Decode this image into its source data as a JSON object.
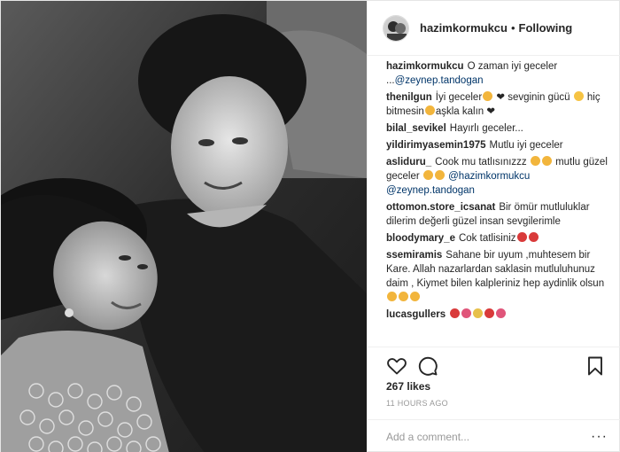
{
  "header": {
    "username": "hazimkormukcu",
    "separator": "•",
    "follow_status": "Following"
  },
  "comments": [
    {
      "user": "hazimkormukcu",
      "parts": [
        {
          "t": "text",
          "v": "O zaman iyi geceler ..."
        },
        {
          "t": "mention",
          "v": "@zeynep.tandogan"
        }
      ]
    },
    {
      "user": "thenilgun",
      "parts": [
        {
          "t": "text",
          "v": "İyi geceler"
        },
        {
          "t": "emoji",
          "c": "#f2b53c"
        },
        {
          "t": "text",
          "v": " ❤ sevginin gücü "
        },
        {
          "t": "emoji",
          "c": "#f6c343"
        },
        {
          "t": "text",
          "v": " hiç bitmesin"
        },
        {
          "t": "emoji",
          "c": "#f2b53c"
        },
        {
          "t": "text",
          "v": "aşkla kalın ❤"
        }
      ]
    },
    {
      "user": "bilal_sevikel",
      "parts": [
        {
          "t": "text",
          "v": "Hayırlı geceler..."
        }
      ]
    },
    {
      "user": "yildirimyasemin1975",
      "parts": [
        {
          "t": "text",
          "v": "Mutlu iyi geceler"
        }
      ]
    },
    {
      "user": "asliduru_",
      "parts": [
        {
          "t": "text",
          "v": "Cook mu tatlısınızzz "
        },
        {
          "t": "emoji",
          "c": "#f2b53c"
        },
        {
          "t": "emoji",
          "c": "#f2b53c"
        },
        {
          "t": "text",
          "v": " mutlu güzel geceler "
        },
        {
          "t": "emoji",
          "c": "#f2b53c"
        },
        {
          "t": "emoji",
          "c": "#f2b53c"
        },
        {
          "t": "text",
          "v": " "
        },
        {
          "t": "mention",
          "v": "@hazimkormukcu @zeynep.tandogan"
        }
      ]
    },
    {
      "user": "ottomon.store_icsanat",
      "parts": [
        {
          "t": "text",
          "v": "Bir ömür mutluluklar dilerim değerli güzel insan sevgilerimle"
        }
      ]
    },
    {
      "user": "bloodymary_e",
      "parts": [
        {
          "t": "text",
          "v": "Cok tatlisiniz"
        },
        {
          "t": "emoji",
          "c": "#d93a3a"
        },
        {
          "t": "emoji",
          "c": "#d93a3a"
        }
      ]
    },
    {
      "user": "ssemiramis",
      "parts": [
        {
          "t": "text",
          "v": "Sahane bir uyum ,muhtesem bir Kare. Allah nazarlardan saklasin mutluluhunuz daim , Kiymet bilen kalpleriniz hep aydinlik olsun"
        },
        {
          "t": "emoji",
          "c": "#f2b53c"
        },
        {
          "t": "emoji",
          "c": "#f2b53c"
        },
        {
          "t": "emoji",
          "c": "#f2b53c"
        }
      ]
    },
    {
      "user": "lucasgullers",
      "parts": [
        {
          "t": "emoji",
          "c": "#d93a3a"
        },
        {
          "t": "emoji",
          "c": "#e0557a"
        },
        {
          "t": "emoji",
          "c": "#e7c04a"
        },
        {
          "t": "emoji",
          "c": "#d93a3a"
        },
        {
          "t": "emoji",
          "c": "#e0557a"
        }
      ]
    }
  ],
  "actions": {
    "like_icon": "heart-outline-icon",
    "comment_icon": "comment-bubble-icon",
    "save_icon": "bookmark-icon"
  },
  "likes": "267 likes",
  "timestamp": "11 HOURS AGO",
  "add_comment": {
    "placeholder": "Add a comment...",
    "more": "···"
  },
  "colors": {
    "text": "#262626",
    "muted": "#999999",
    "mention": "#003569",
    "border": "#efefef"
  }
}
